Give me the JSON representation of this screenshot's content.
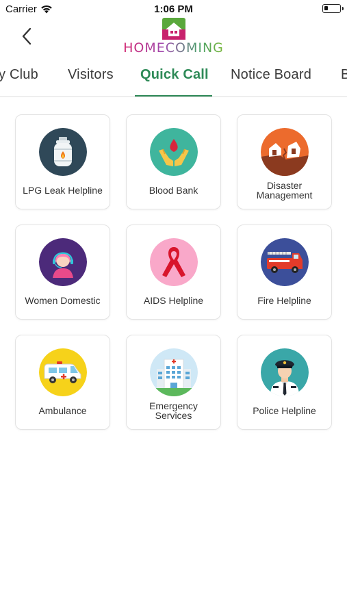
{
  "status_bar": {
    "carrier": "Carrier",
    "time": "1:06 PM",
    "battery_level": 0.25
  },
  "header": {
    "back_icon": "chevron-left-icon",
    "logo_text": "HOMECOMING"
  },
  "tabs": [
    {
      "label": "y Club",
      "active": false
    },
    {
      "label": "Visitors",
      "active": false
    },
    {
      "label": "Quick Call",
      "active": true
    },
    {
      "label": "Notice Board",
      "active": false
    },
    {
      "label": "B",
      "active": false
    }
  ],
  "colors": {
    "accent": "#2e8a57",
    "card_border": "#e3e3e3"
  },
  "services": [
    {
      "label": "LPG Leak Helpline",
      "icon": "gas-cylinder-icon"
    },
    {
      "label": "Blood Bank",
      "icon": "blood-drop-hands-icon"
    },
    {
      "label": "Disaster Management",
      "icon": "collapsed-house-icon"
    },
    {
      "label": "Women Domestic",
      "icon": "woman-headset-icon"
    },
    {
      "label": "AIDS Helpline",
      "icon": "red-ribbon-icon"
    },
    {
      "label": "Fire Helpline",
      "icon": "fire-truck-icon"
    },
    {
      "label": "Ambulance",
      "icon": "ambulance-icon"
    },
    {
      "label": "Emergency Services",
      "icon": "hospital-icon"
    },
    {
      "label": "Police Helpline",
      "icon": "police-officer-icon"
    }
  ]
}
